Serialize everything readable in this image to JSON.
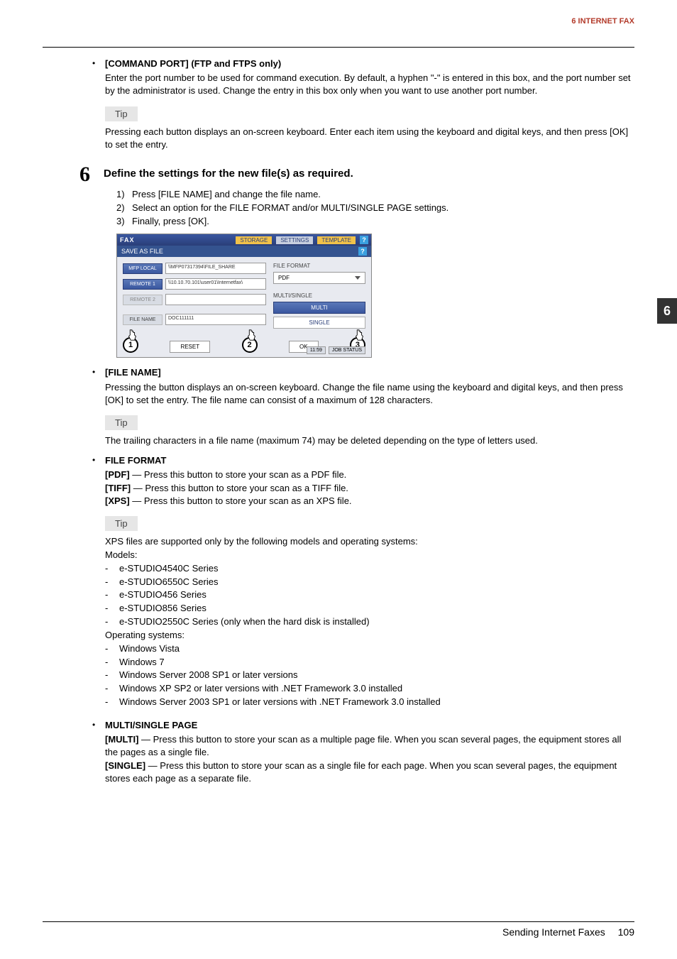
{
  "header": {
    "section": "6 INTERNET FAX"
  },
  "side_tab": "6",
  "cmd_port": {
    "title": "[COMMAND PORT] (FTP and FTPS only)",
    "body": "Enter the port number to be used for command execution. By default, a hyphen \"-\" is entered in this box, and the port number set by the administrator is used. Change the entry in this box only when you want to use another port number."
  },
  "tip_label": "Tip",
  "tip1_body": "Pressing each button displays an on-screen keyboard. Enter each item using the keyboard and digital keys, and then press [OK] to set the entry.",
  "step6": {
    "num": "6",
    "title": "Define the settings for the new file(s) as required.",
    "items": {
      "1": "Press [FILE NAME] and change the file name.",
      "2": "Select an option for the FILE FORMAT and/or MULTI/SINGLE PAGE settings.",
      "3": "Finally, press [OK]."
    }
  },
  "screenshot": {
    "fax_label": "FAX",
    "storage_tab": "STORAGE",
    "settings_tab": "SETTINGS",
    "template_tab": "TEMPLATE",
    "help_q": "?",
    "subtitle": "SAVE AS FILE",
    "mfp_local": "MFP LOCAL",
    "mfp_local_path": "\\\\MFP07317394\\FILE_SHARE",
    "remote1": "REMOTE 1",
    "remote1_path": "\\\\10.10.70.101\\user01\\Internetfax\\",
    "remote2": "REMOTE 2",
    "file_name_btn": "FILE NAME",
    "file_name_val": "DOC111111",
    "file_format_lbl": "FILE FORMAT",
    "file_format_val": "PDF",
    "multi_single_lbl": "MULTI/SINGLE",
    "multi_btn": "MULTI",
    "single_btn": "SINGLE",
    "reset_btn": "RESET",
    "ok_btn": "OK",
    "time": "11:59",
    "job": "JOB STATUS",
    "c1": "1",
    "c2": "2",
    "c3": "3"
  },
  "file_name": {
    "title": "[FILE NAME]",
    "body": "Pressing the button displays an on-screen keyboard. Change the file name using the keyboard and digital keys, and then press [OK] to set the entry. The file name can consist of a maximum of 128 characters."
  },
  "tip2_body": "The trailing characters in a file name (maximum 74) may be deleted depending on the type of letters used.",
  "file_format": {
    "title": "FILE FORMAT",
    "pdf_l": "[PDF]",
    "pdf_b": " — Press this button to store your scan as a PDF file.",
    "tiff_l": "[TIFF]",
    "tiff_b": " — Press this button to store your scan as a TIFF file.",
    "xps_l": "[XPS]",
    "xps_b": " — Press this button to store your scan as an XPS file."
  },
  "tip3": {
    "line1": "XPS files are supported only by the following models and operating systems:",
    "models_lbl": "Models:",
    "m1": "e-STUDIO4540C Series",
    "m2": "e-STUDIO6550C Series",
    "m3": "e-STUDIO456 Series",
    "m4": "e-STUDIO856 Series",
    "m5": "e-STUDIO2550C Series (only when the hard disk is installed)",
    "os_lbl": "Operating systems:",
    "o1": "Windows Vista",
    "o2": "Windows 7",
    "o3": "Windows Server 2008 SP1 or later versions",
    "o4": "Windows XP SP2 or later versions with .NET Framework 3.0 installed",
    "o5": "Windows Server 2003 SP1 or later versions with .NET Framework 3.0 installed"
  },
  "multi_single": {
    "title": "MULTI/SINGLE PAGE",
    "multi_l": "[MULTI]",
    "multi_b": " — Press this button to store your scan as a multiple page file. When you scan several pages, the equipment stores all the pages as a single file.",
    "single_l": "[SINGLE]",
    "single_b": " — Press this button to store your scan as a single file for each page. When you scan several pages, the equipment stores each page as a separate file."
  },
  "footer": {
    "title": "Sending Internet Faxes",
    "page": "109"
  }
}
